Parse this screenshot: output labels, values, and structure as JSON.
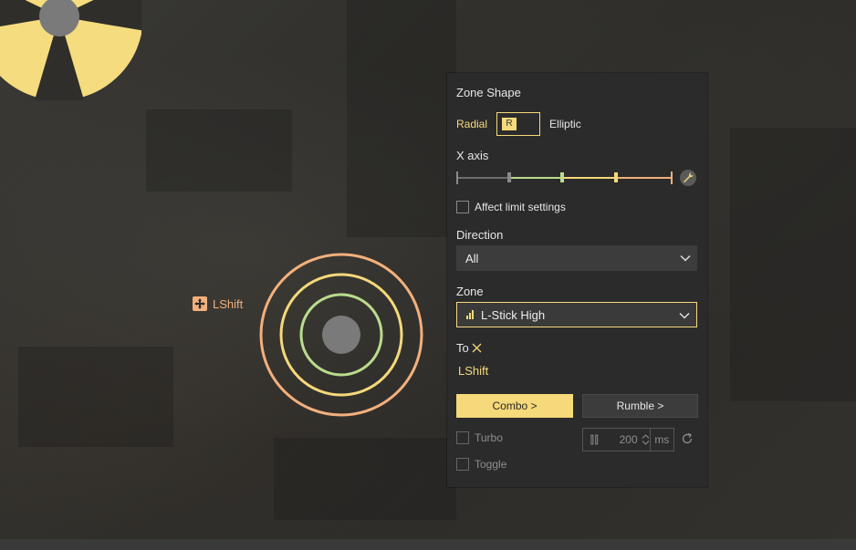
{
  "canvas": {
    "key_label": "LShift",
    "rings": [
      {
        "name": "outer",
        "color": "#f2b07c"
      },
      {
        "name": "middle",
        "color": "#f5d97a"
      },
      {
        "name": "inner",
        "color": "#b9dc8e"
      },
      {
        "name": "center",
        "color": "#7a7a7a"
      }
    ]
  },
  "panel": {
    "zone_shape_label": "Zone Shape",
    "shape_radial": "Radial",
    "shape_toggle_knob": "R",
    "shape_elliptic": "Elliptic",
    "x_axis_label": "X axis",
    "slider_colors": [
      "#6d6d6d",
      "#b9dc8e",
      "#f5d97a",
      "#f2b07c"
    ],
    "affect_limit_label": "Affect limit settings",
    "affect_limit_checked": false,
    "direction_label": "Direction",
    "direction_value": "All",
    "zone_label": "Zone",
    "zone_value": "L-Stick High",
    "to_label": "To",
    "to_key": "LShift",
    "combo_button": "Combo >",
    "rumble_button": "Rumble >",
    "turbo_label": "Turbo",
    "turbo_checked": false,
    "toggle_label": "Toggle",
    "toggle_checked": false,
    "interval_value": "200",
    "interval_unit": "ms"
  },
  "colors": {
    "accent_yellow": "#f5d97a",
    "accent_orange": "#f2b07c",
    "accent_green": "#b9dc8e",
    "panel_bg": "#2b2b2b"
  }
}
